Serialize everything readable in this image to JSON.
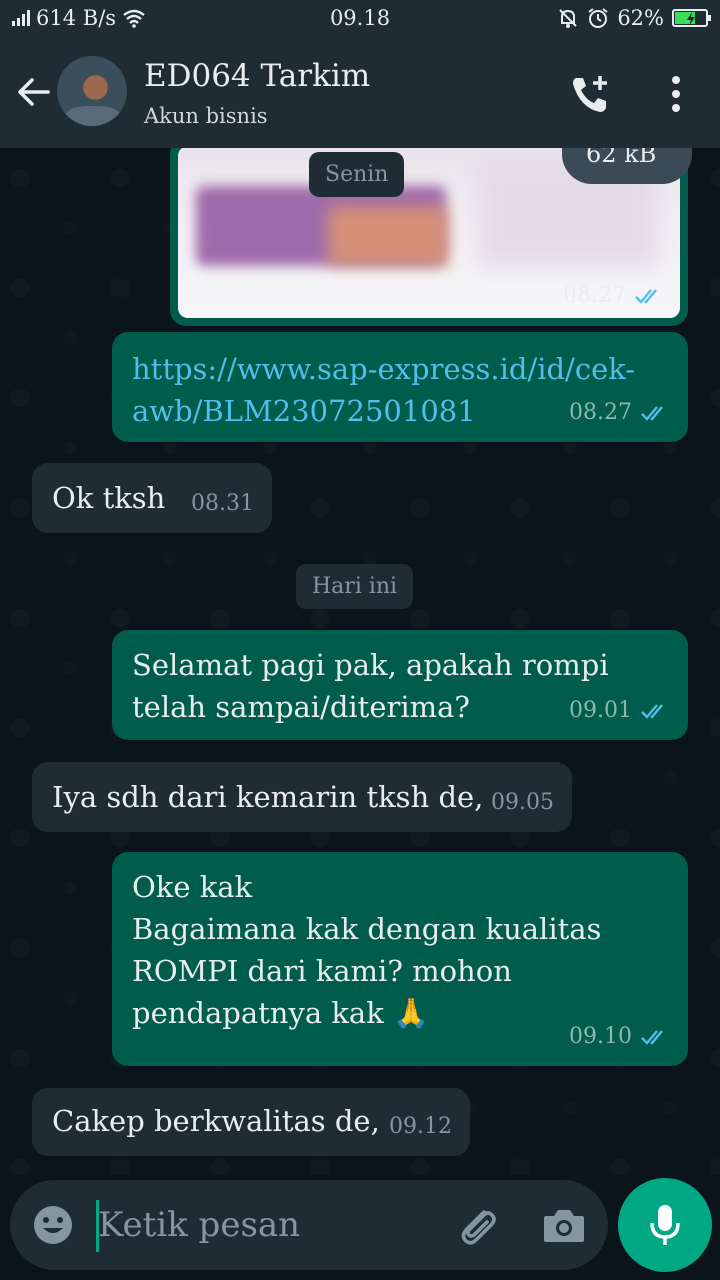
{
  "status_bar": {
    "net_speed": "614 B/s",
    "time": "09.18",
    "battery": "62%",
    "battery_level": 0.62
  },
  "header": {
    "contact_name": "ED064 Tarkim",
    "subtitle": "Akun bisnis"
  },
  "messages": {
    "image_msg": {
      "size": "62 kB",
      "time": "08.27",
      "status": "read"
    },
    "day_monday": "Senin",
    "link_msg": {
      "text": "https://www.sap-express.id/id/cek-awb/BLM23072501081",
      "line1": "https://www.sap-express.id/id/cek-",
      "line2": "awb/BLM23072501081",
      "time": "08.27"
    },
    "in_1": {
      "text": "Ok tksh",
      "time": "08.31"
    },
    "day_today": "Hari ini",
    "out_2": {
      "line1": "Selamat pagi pak, apakah rompi",
      "line2": "telah sampai/diterima?",
      "time": "09.01"
    },
    "in_2": {
      "text": "Iya sdh dari kemarin tksh de,",
      "time": "09.05"
    },
    "out_3": {
      "line1": "Oke kak",
      "line2": "Bagaimana kak dengan kualitas",
      "line3": "ROMPI dari kami? mohon",
      "line4": "pendapatnya kak 🙏",
      "time": "09.10"
    },
    "in_3": {
      "text": "Cakep berkwalitas de,",
      "time": "09.12"
    }
  },
  "composer": {
    "placeholder": "Ketik pesan"
  },
  "colors": {
    "outgoing_bubble": "#005c4b",
    "incoming_bubble": "#1f2c34",
    "accent": "#00a884",
    "read_tick": "#53bdeb"
  }
}
